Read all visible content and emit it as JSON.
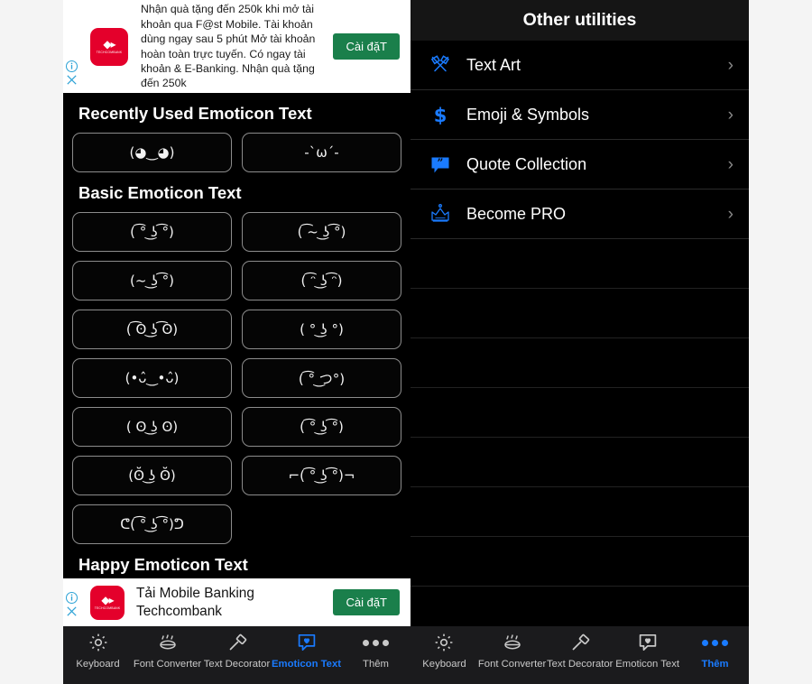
{
  "background_color": "#f4f4f4",
  "left_phone": {
    "top_ad": {
      "brand": "TECHCOMBANK",
      "body": "Nhận quà tặng đến 250k khi mở tài khoản qua F@st Mobile. Tài khoản dùng ngay sau 5 phút Mở tài khoản hoàn toàn trực tuyến. Có ngay tài khoản & E-Banking. Nhận quà tặng đến 250k",
      "cta_label": "Cài đặT",
      "cta_color": "#1a7f4b",
      "info_icon": "info-icon",
      "close_icon": "close-icon"
    },
    "sections": [
      {
        "title": "Recently Used Emoticon Text",
        "items": [
          "(◕‿◕)",
          "-`ω´-"
        ]
      },
      {
        "title": "Basic Emoticon Text",
        "items": [
          "( ͡° ͜ʖ ͡°)",
          "( ͡~ ͜ʖ ͡°)",
          "(~ ͜ʖ ͡°)",
          "( ͡ᵔ ͜ʖ ͡ᵔ)",
          "( ͡ʘ ͜ʖ ͡ʘ)",
          "( ° ͜ʖ °)",
          "(•ᴗ̂‿•ᴗ̂)",
          "( ͡° ͜つ°)",
          "( ʘ ͜ʖ ʘ)",
          "( ͡°  ͜ʖ ͡°)",
          "(ʘ̆ ͜ʖ ʘ̆)",
          "⌐( ͡° ͜ʖ ͡°)¬",
          "ᕦ( ͡° ͜ʖ ͡°)ᕤ"
        ]
      },
      {
        "title": "Happy Emoticon Text",
        "items": []
      }
    ],
    "bottom_ad": {
      "line1": "Tải Mobile Banking",
      "line2": "Techcombank",
      "brand": "TECHCOMBANK",
      "cta_label": "Cài đặT",
      "info_icon": "info-icon",
      "close_icon": "close-icon"
    },
    "tabbar": {
      "active_index": 3,
      "accent": "#1a7bff",
      "tabs": [
        {
          "label": "Keyboard",
          "icon": "gear-icon"
        },
        {
          "label": "Font Converter",
          "icon": "font-converter-icon"
        },
        {
          "label": "Text Decorator",
          "icon": "paint-roller-icon"
        },
        {
          "label": "Emoticon Text",
          "icon": "heart-chat-icon"
        },
        {
          "label": "Thêm",
          "icon": "more-dots-icon"
        }
      ]
    }
  },
  "right_phone": {
    "header": {
      "title": "Other utilities"
    },
    "utilities": [
      {
        "label": "Text Art",
        "icon": "crossed-brushes-icon",
        "chevron": "›"
      },
      {
        "label": "Emoji & Symbols",
        "icon": "dollar-icon",
        "chevron": "›"
      },
      {
        "label": "Quote Collection",
        "icon": "quote-bubble-icon",
        "chevron": "›"
      },
      {
        "label": "Become PRO",
        "icon": "crown-icon",
        "chevron": "›"
      }
    ],
    "empty_row_count": 8,
    "tabbar": {
      "active_index": 4,
      "accent": "#1a7bff",
      "tabs": [
        {
          "label": "Keyboard",
          "icon": "gear-icon"
        },
        {
          "label": "Font Converter",
          "icon": "font-converter-icon"
        },
        {
          "label": "Text Decorator",
          "icon": "paint-roller-icon"
        },
        {
          "label": "Emoticon Text",
          "icon": "heart-chat-icon"
        },
        {
          "label": "Thêm",
          "icon": "more-dots-icon"
        }
      ]
    }
  }
}
